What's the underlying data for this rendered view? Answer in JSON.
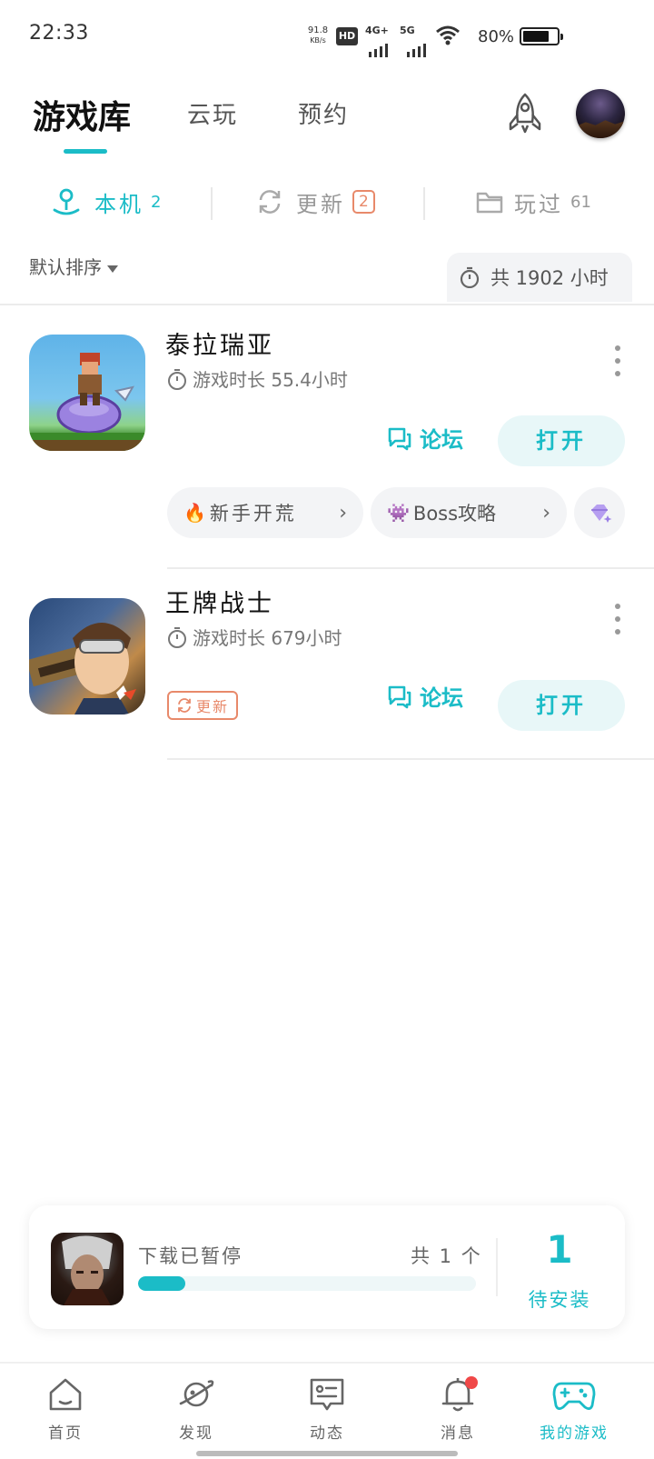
{
  "status_bar": {
    "time": "22:33",
    "net_speed_value": "91.8",
    "net_speed_unit": "KB/s",
    "hd_label": "HD",
    "sim1_label": "4G+",
    "sim2_label": "5G",
    "battery_percent": "80%",
    "battery_level": 0.8
  },
  "header": {
    "tabs": [
      {
        "label": "游戏库",
        "active": true
      },
      {
        "label": "云玩",
        "active": false
      },
      {
        "label": "预约",
        "active": false
      }
    ],
    "rocket_icon": "rocket-icon",
    "avatar_icon": "avatar"
  },
  "segments": [
    {
      "label": "本机",
      "count": "2",
      "icon": "local-device-icon",
      "active": true
    },
    {
      "label": "更新",
      "count": "2",
      "icon": "refresh-icon",
      "active": false
    },
    {
      "label": "玩过",
      "count": "61",
      "icon": "folder-icon",
      "active": false
    }
  ],
  "sort": {
    "label": "默认排序"
  },
  "total_time": {
    "label": "共 1902 小时"
  },
  "games": [
    {
      "title": "泰拉瑞亚",
      "playtime": "游戏时长 55.4小时",
      "forum_label": "论坛",
      "open_label": "打开",
      "chips": [
        {
          "emoji": "🔥",
          "label": "新手开荒"
        },
        {
          "emoji": "👾",
          "label": "Boss攻略"
        }
      ]
    },
    {
      "title": "王牌战士",
      "playtime": "游戏时长 679小时",
      "forum_label": "论坛",
      "open_label": "打开",
      "badge": "更新"
    }
  ],
  "download": {
    "status": "下载已暂停",
    "count_label": "共 1 个",
    "progress": 0.14,
    "pending_count": "1",
    "pending_label": "待安装"
  },
  "nav": [
    {
      "label": "首页",
      "icon": "home-icon",
      "active": false
    },
    {
      "label": "发现",
      "icon": "planet-icon",
      "active": false
    },
    {
      "label": "动态",
      "icon": "chat-card-icon",
      "active": false
    },
    {
      "label": "消息",
      "icon": "bell-icon",
      "active": false
    },
    {
      "label": "我的游戏",
      "icon": "gamepad-icon",
      "active": true
    }
  ],
  "colors": {
    "accent": "#1bbcc7",
    "update": "#e8896a",
    "notification": "#f04848"
  }
}
